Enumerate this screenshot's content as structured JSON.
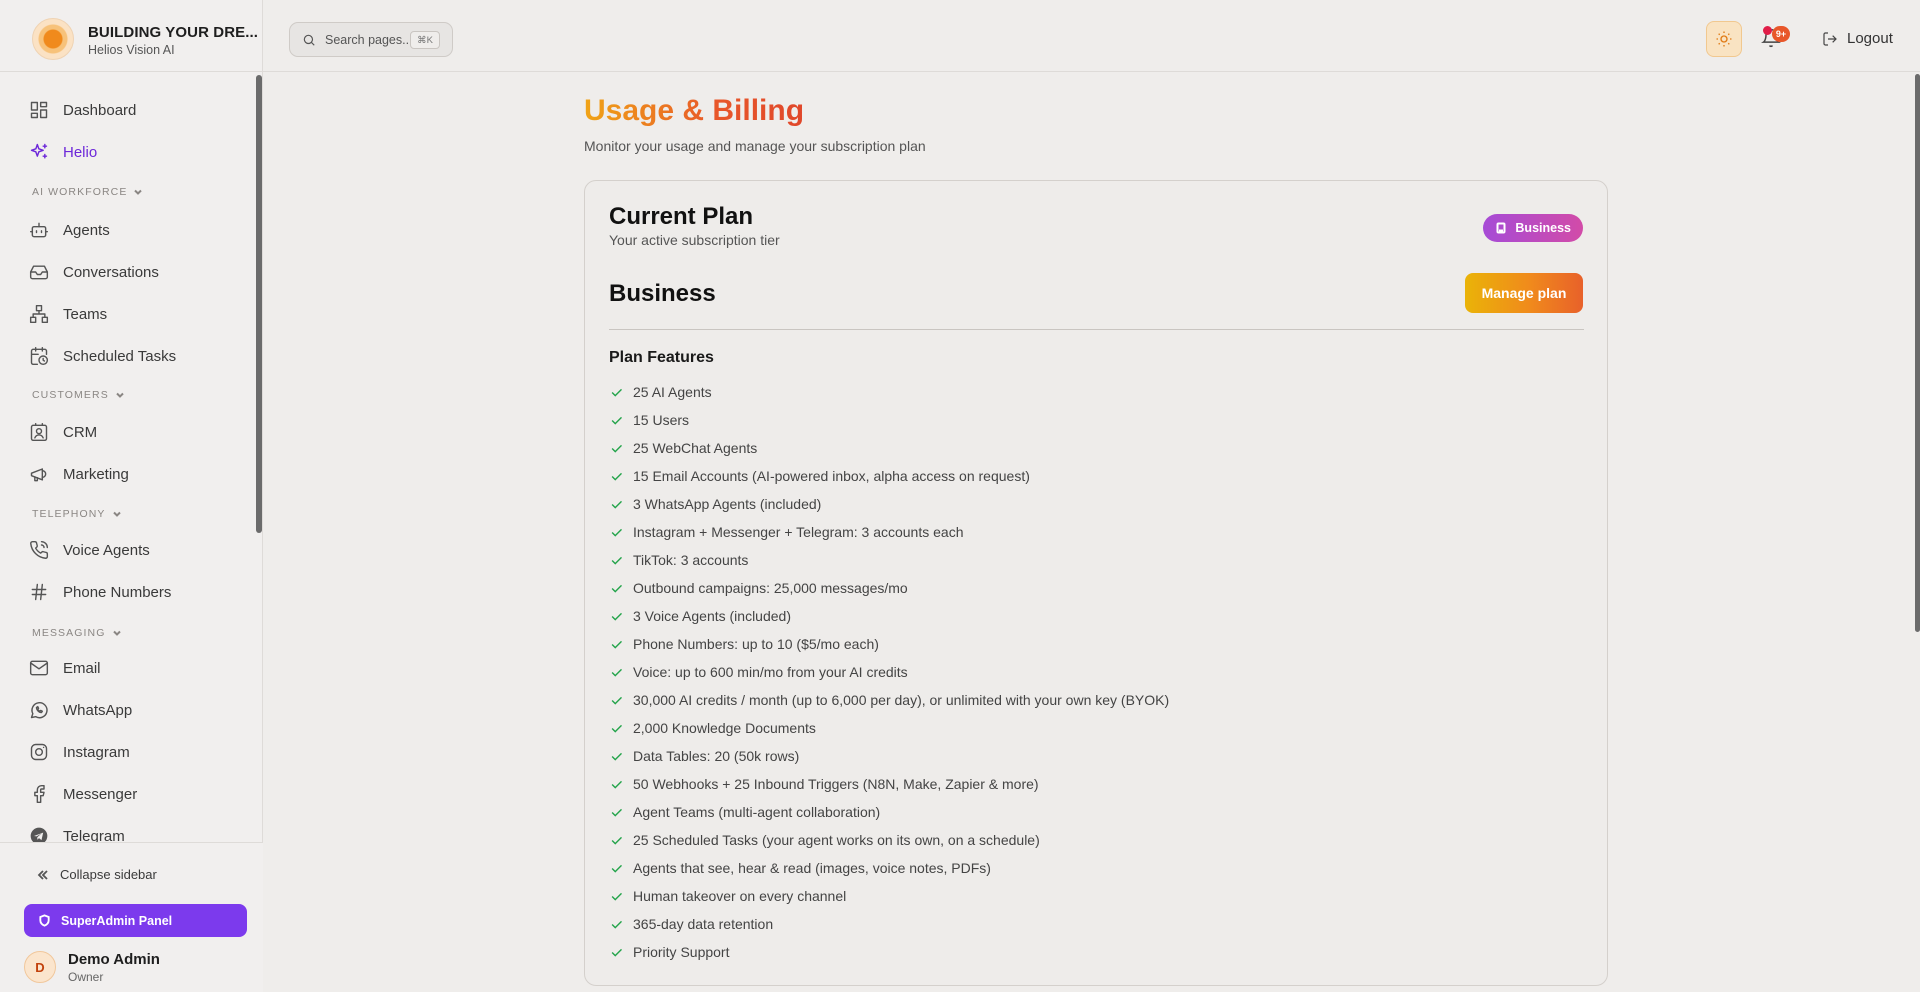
{
  "brand": {
    "title": "BUILDING YOUR DRE...",
    "subtitle": "Helios Vision AI"
  },
  "nav": {
    "dashboard": "Dashboard",
    "helio": "Helio",
    "section_ai": "AI WORKFORCE",
    "agents": "Agents",
    "conversations": "Conversations",
    "teams": "Teams",
    "scheduled": "Scheduled Tasks",
    "section_customers": "CUSTOMERS",
    "crm": "CRM",
    "marketing": "Marketing",
    "section_telephony": "TELEPHONY",
    "voice": "Voice Agents",
    "phone": "Phone Numbers",
    "section_messaging": "MESSAGING",
    "email": "Email",
    "whatsapp": "WhatsApp",
    "instagram": "Instagram",
    "messenger": "Messenger",
    "telegram": "Telegram"
  },
  "footer": {
    "collapse": "Collapse sidebar",
    "superadmin": "SuperAdmin Panel",
    "user_initial": "D",
    "user_name": "Demo Admin",
    "user_role": "Owner"
  },
  "topbar": {
    "search_placeholder": "Search pages...",
    "search_shortcut": "⌘K",
    "notification_count": "9+",
    "logout": "Logout"
  },
  "page": {
    "title": "Usage & Billing",
    "subtitle": "Monitor your usage and manage your subscription plan"
  },
  "plan": {
    "card_title": "Current Plan",
    "card_subtitle": "Your active subscription tier",
    "badge": "Business",
    "name": "Business",
    "manage_label": "Manage plan",
    "features_title": "Plan Features",
    "features": [
      "25 AI Agents",
      "15 Users",
      "25 WebChat Agents",
      "15 Email Accounts (AI-powered inbox, alpha access on request)",
      "3 WhatsApp Agents (included)",
      "Instagram + Messenger + Telegram: 3 accounts each",
      "TikTok: 3 accounts",
      "Outbound campaigns: 25,000 messages/mo",
      "3 Voice Agents (included)",
      "Phone Numbers: up to 10 ($5/mo each)",
      "Voice: up to 600 min/mo from your AI credits",
      "30,000 AI credits / month (up to 6,000 per day), or unlimited with your own key (BYOK)",
      "2,000 Knowledge Documents",
      "Data Tables: 20 (50k rows)",
      "50 Webhooks + 25 Inbound Triggers (N8N, Make, Zapier & more)",
      "Agent Teams (multi-agent collaboration)",
      "25 Scheduled Tasks (your agent works on its own, on a schedule)",
      "Agents that see, hear & read (images, voice notes, PDFs)",
      "Human takeover on every channel",
      "365-day data retention",
      "Priority Support"
    ]
  },
  "colors": {
    "accent": "#7c3aed",
    "brand_orange": "#e8572a",
    "check": "#22a34a"
  },
  "icons": {
    "dashboard": "dashboard-icon",
    "helio": "sparkles-icon",
    "agents": "bot-icon",
    "conversations": "inbox-icon",
    "teams": "network-icon",
    "scheduled": "calendar-clock-icon",
    "crm": "contact-icon",
    "marketing": "megaphone-icon",
    "voice": "phone-call-icon",
    "phone": "hash-icon",
    "email": "mail-icon",
    "whatsapp": "whatsapp-icon",
    "instagram": "instagram-icon",
    "messenger": "facebook-icon",
    "telegram": "telegram-icon"
  }
}
